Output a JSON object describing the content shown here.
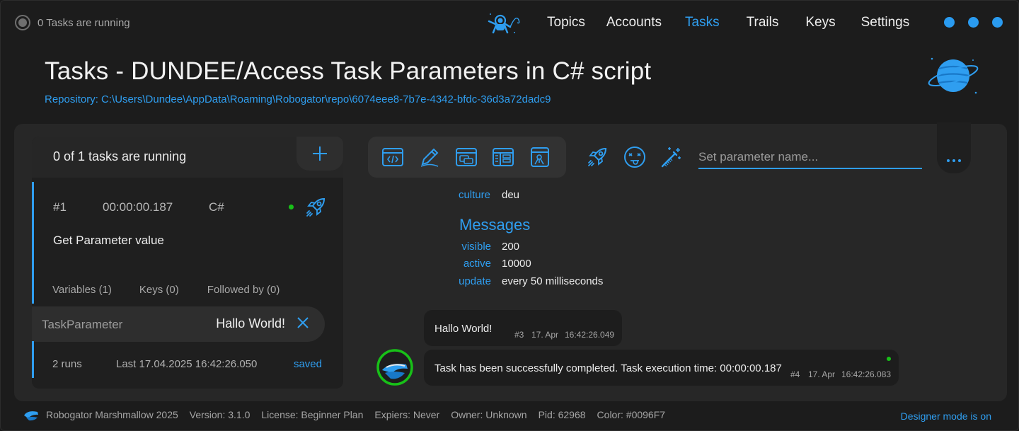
{
  "app": {
    "status_text": "0 Tasks are running",
    "nav": [
      "Topics",
      "Accounts",
      "Tasks",
      "Trails",
      "Keys",
      "Settings"
    ],
    "active_nav": "Tasks",
    "accent": "#2F9EF0"
  },
  "header": {
    "title": "Tasks - DUNDEE/Access Task Parameters in C# script",
    "repository": "Repository: C:\\Users\\Dundee\\AppData\\Roaming\\Robogator\\repo\\6074eee8-7b7e-4342-bfdc-36d3a72dadc9"
  },
  "task_list": {
    "summary": "0 of 1 tasks are running",
    "add_icon": "plus-icon",
    "task": {
      "id": "#1",
      "duration": "00:00:00.187",
      "language": "C#",
      "name": "Get Parameter value",
      "status_color": "#18C018",
      "tabs": [
        "Variables (1)",
        "Keys (0)",
        "Followed by (0)"
      ]
    },
    "parameter": {
      "name": "TaskParameter",
      "value": "Hallo World!"
    },
    "runs": {
      "count": "2 runs",
      "last": "Last 17.04.2025 16:42:26.050",
      "state": "saved"
    }
  },
  "toolbar": {
    "buttons": [
      "code-window-icon",
      "pencil-icon",
      "windows-icon",
      "layout-icon",
      "script-file-icon"
    ],
    "actions": [
      "rocket-icon",
      "dizzy-face-icon",
      "magic-wand-icon"
    ],
    "param_placeholder": "Set parameter name...",
    "more_icon": "more-dots-icon"
  },
  "info": {
    "culture_key": "culture",
    "culture_value": "deu",
    "messages_title": "Messages",
    "visible_key": "visible",
    "visible_value": "200",
    "active_key": "active",
    "active_value": "10000",
    "update_key": "update",
    "update_value": "every 50 milliseconds"
  },
  "messages": [
    {
      "text": "Hallo World!",
      "id": "#3",
      "date": "17. Apr",
      "time": "16:42:26.049"
    },
    {
      "text": "Task has been successfully completed. Task execution time: 00:00:00.187",
      "id": "#4",
      "date": "17. Apr",
      "time": "16:42:26.083"
    }
  ],
  "footer": {
    "items": [
      "Robogator Marshmallow 2025",
      "Version: 3.1.0",
      "License: Beginner Plan",
      "Expiers: Never",
      "Owner: Unknown",
      "Pid: 62968",
      "Color: #0096F7"
    ],
    "designer_mode": "Designer mode is on"
  }
}
